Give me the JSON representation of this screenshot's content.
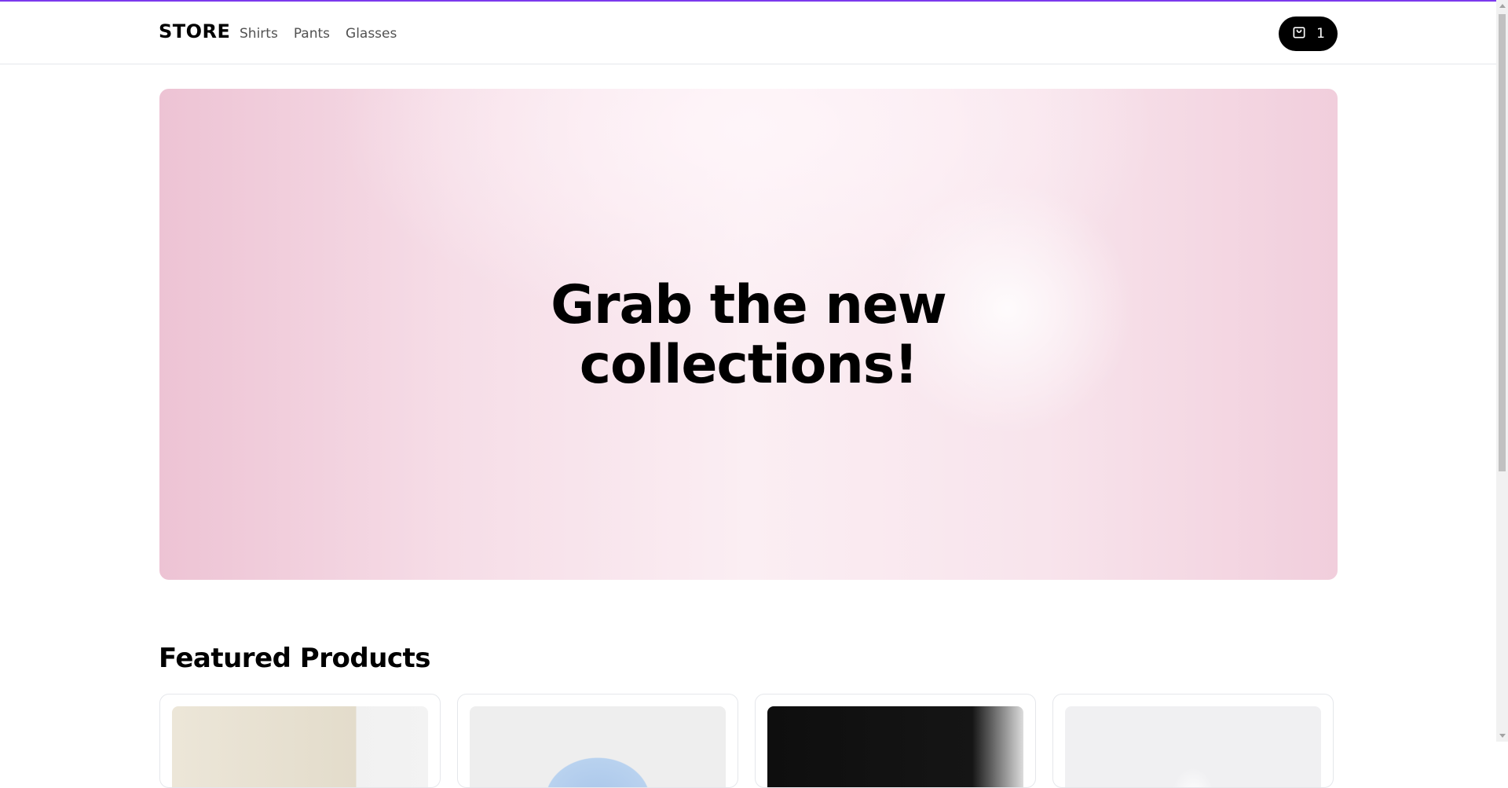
{
  "header": {
    "logo": "STORE",
    "nav": [
      "Shirts",
      "Pants",
      "Glasses"
    ],
    "cart_count": "1",
    "accent_color": "#7c3aed"
  },
  "hero": {
    "title_line1": "Grab the new",
    "title_line2": "collections!"
  },
  "featured": {
    "title": "Featured Products"
  },
  "icons": {
    "cart": "shopping-bag-icon"
  }
}
